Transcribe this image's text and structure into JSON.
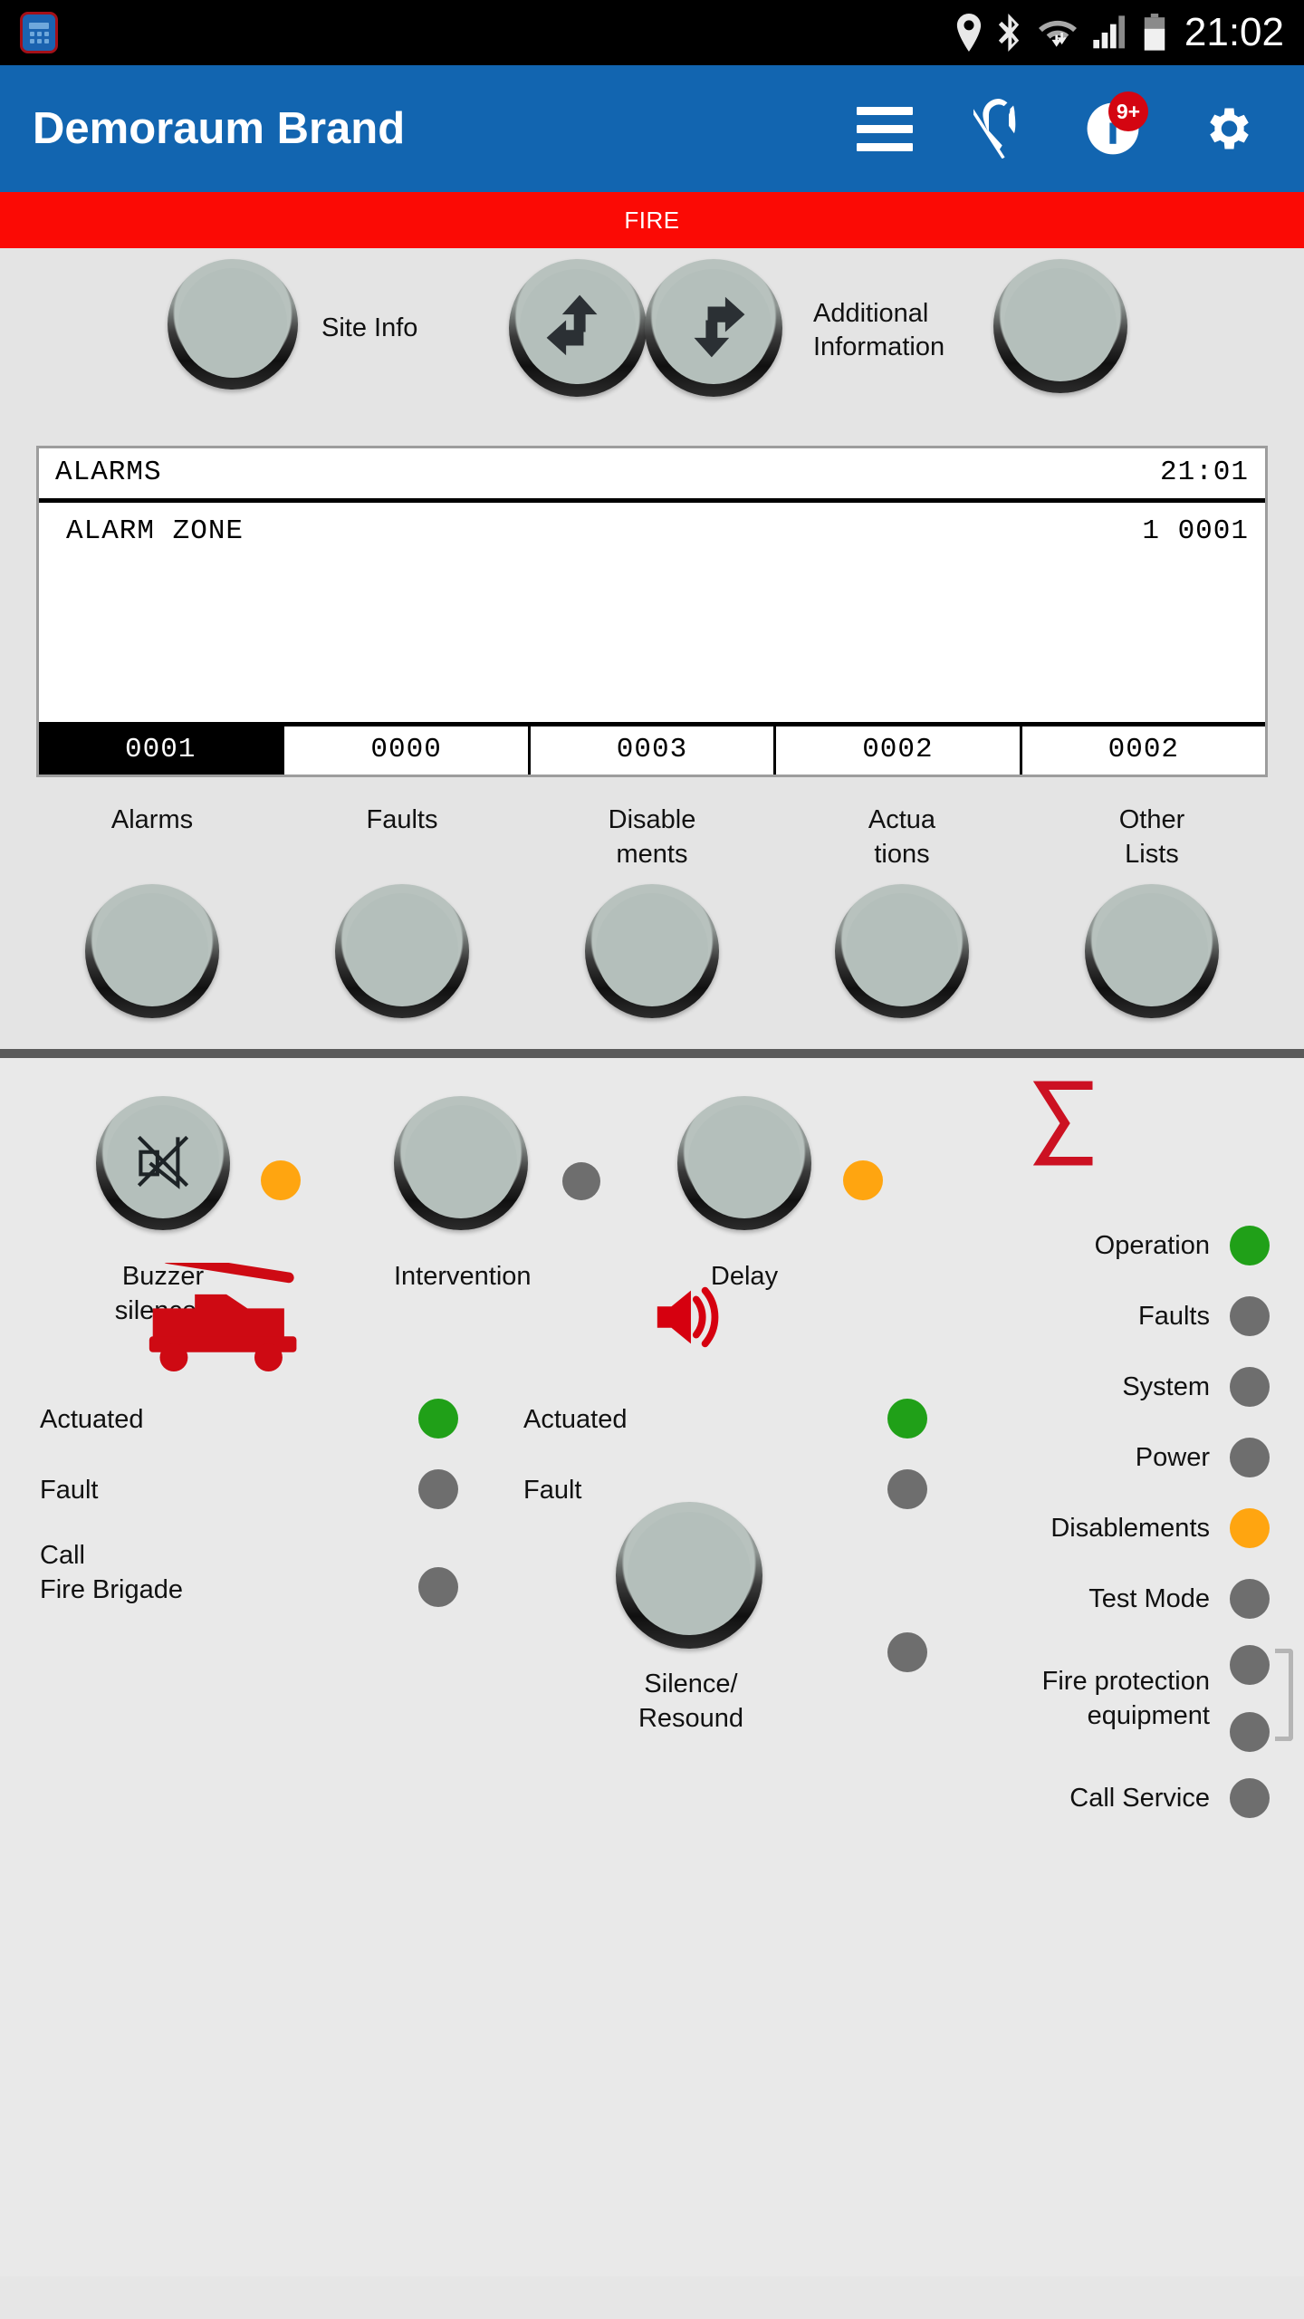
{
  "statusbar": {
    "clock": "21:02",
    "icons": [
      "location-icon",
      "bluetooth-icon",
      "wifi-icon",
      "signal-icon",
      "battery-icon"
    ],
    "app_icon": "keypad-app-icon"
  },
  "appbar": {
    "title": "Demoraum Brand",
    "menu_icon": "hamburger-menu-icon",
    "location_off_icon": "location-off-icon",
    "info_icon": "info-icon",
    "info_badge": "9+",
    "settings_icon": "gear-icon",
    "background": "#1265b0"
  },
  "banner": {
    "text": "FIRE",
    "color": "#fb0a05"
  },
  "nav": {
    "site_info_label": "Site Info",
    "prev_icon": "nav-previous-icon",
    "next_icon": "nav-next-icon",
    "additional_info_label": "Additional\nInformation",
    "additional_info_line1": "Additional",
    "additional_info_line2": "Information"
  },
  "lcd": {
    "title": "ALARMS",
    "time": "21:01",
    "rows": [
      {
        "text": "ALARM  ZONE",
        "value": "1  0001"
      }
    ],
    "counters": [
      {
        "value": "0001",
        "selected": true
      },
      {
        "value": "0000",
        "selected": false
      },
      {
        "value": "0003",
        "selected": false
      },
      {
        "value": "0002",
        "selected": false
      },
      {
        "value": "0002",
        "selected": false
      }
    ]
  },
  "list_buttons": [
    {
      "label": "Alarms",
      "line1": "Alarms",
      "line2": ""
    },
    {
      "label": "Faults",
      "line1": "Faults",
      "line2": ""
    },
    {
      "label": "Disablements",
      "line1": "Disable",
      "line2": "ments"
    },
    {
      "label": "Actuations",
      "line1": "Actua",
      "line2": "tions"
    },
    {
      "label": "Other Lists",
      "line1": "Other",
      "line2": "Lists"
    }
  ],
  "controls": {
    "buzzer": {
      "line1": "Buzzer",
      "line2": "silenced",
      "icon": "speaker-muted-icon",
      "led": "#ffa510"
    },
    "intervention": {
      "label": "Intervention",
      "led": "#6e6e6e"
    },
    "delay": {
      "label": "Delay",
      "led": "#ffa510"
    },
    "silence_resound": {
      "line1": "Silence/",
      "line2": "Resound"
    }
  },
  "brigade_group": {
    "icon": "fire-truck-icon",
    "rows": [
      {
        "label": "Actuated",
        "line1": "Actuated",
        "line2": "",
        "led": "#20a018"
      },
      {
        "label": "Fault",
        "line1": "Fault",
        "line2": "",
        "led": "#6e6e6e"
      },
      {
        "label": "Call Fire Brigade",
        "line1": "Call",
        "line2": "Fire Brigade",
        "led": "#6e6e6e"
      }
    ]
  },
  "sounder_group": {
    "icon": "speaker-loud-icon",
    "rows": [
      {
        "label": "Actuated",
        "led": "#20a018"
      },
      {
        "label": "Fault",
        "led": "#6e6e6e"
      },
      {
        "label": "",
        "led": "#6e6e6e"
      }
    ]
  },
  "status_panel": {
    "sigma_icon": "sigma-icon",
    "rows": [
      {
        "label": "Operation",
        "line1": "Operation",
        "line2": "",
        "led": "#20a018"
      },
      {
        "label": "Faults",
        "line1": "Faults",
        "line2": "",
        "led": "#6e6e6e"
      },
      {
        "label": "System",
        "line1": "System",
        "line2": "",
        "led": "#6e6e6e"
      },
      {
        "label": "Power",
        "line1": "Power",
        "line2": "",
        "led": "#6e6e6e"
      },
      {
        "label": "Disablements",
        "line1": "Disablements",
        "line2": "",
        "led": "#ffa510"
      },
      {
        "label": "Test Mode",
        "line1": "Test Mode",
        "line2": "",
        "led": "#6e6e6e"
      },
      {
        "label": "Fire protection equipment",
        "line1": "Fire protection",
        "line2": "equipment",
        "led": "#6e6e6e",
        "led2": "#6e6e6e",
        "bracket": true
      },
      {
        "label": "Call Service",
        "line1": "Call Service",
        "line2": "",
        "led": "#6e6e6e"
      }
    ]
  }
}
